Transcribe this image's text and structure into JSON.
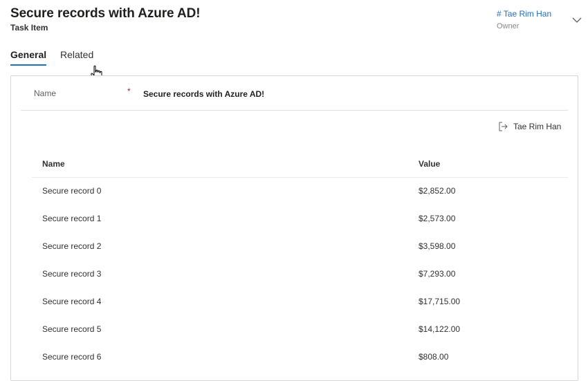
{
  "header": {
    "title": "Secure records with Azure AD!",
    "subtitle": "Task Item",
    "owner_name": "# Tae Rim Han",
    "owner_label": "Owner"
  },
  "tabs": [
    {
      "label": "General",
      "active": true
    },
    {
      "label": "Related",
      "active": false
    }
  ],
  "form": {
    "name_label": "Name",
    "required_marker": "*",
    "name_value": "Secure records with Azure AD!",
    "owner_link": "Tae Rim Han"
  },
  "table": {
    "columns": [
      "Name",
      "Value"
    ],
    "rows": [
      {
        "name": "Secure record 0",
        "value": "$2,852.00"
      },
      {
        "name": "Secure record 1",
        "value": "$2,573.00"
      },
      {
        "name": "Secure record 2",
        "value": "$3,598.00"
      },
      {
        "name": "Secure record 3",
        "value": "$7,293.00"
      },
      {
        "name": "Secure record 4",
        "value": "$17,715.00"
      },
      {
        "name": "Secure record 5",
        "value": "$14,122.00"
      },
      {
        "name": "Secure record 6",
        "value": "$808.00"
      }
    ]
  },
  "icons": {
    "owner_link_icon": "open-record-icon",
    "expand_icon": "chevron-down-icon",
    "cursor": "hand-cursor-icon"
  },
  "colors": {
    "accent": "#1f6fc5",
    "required": "#a4262c"
  }
}
